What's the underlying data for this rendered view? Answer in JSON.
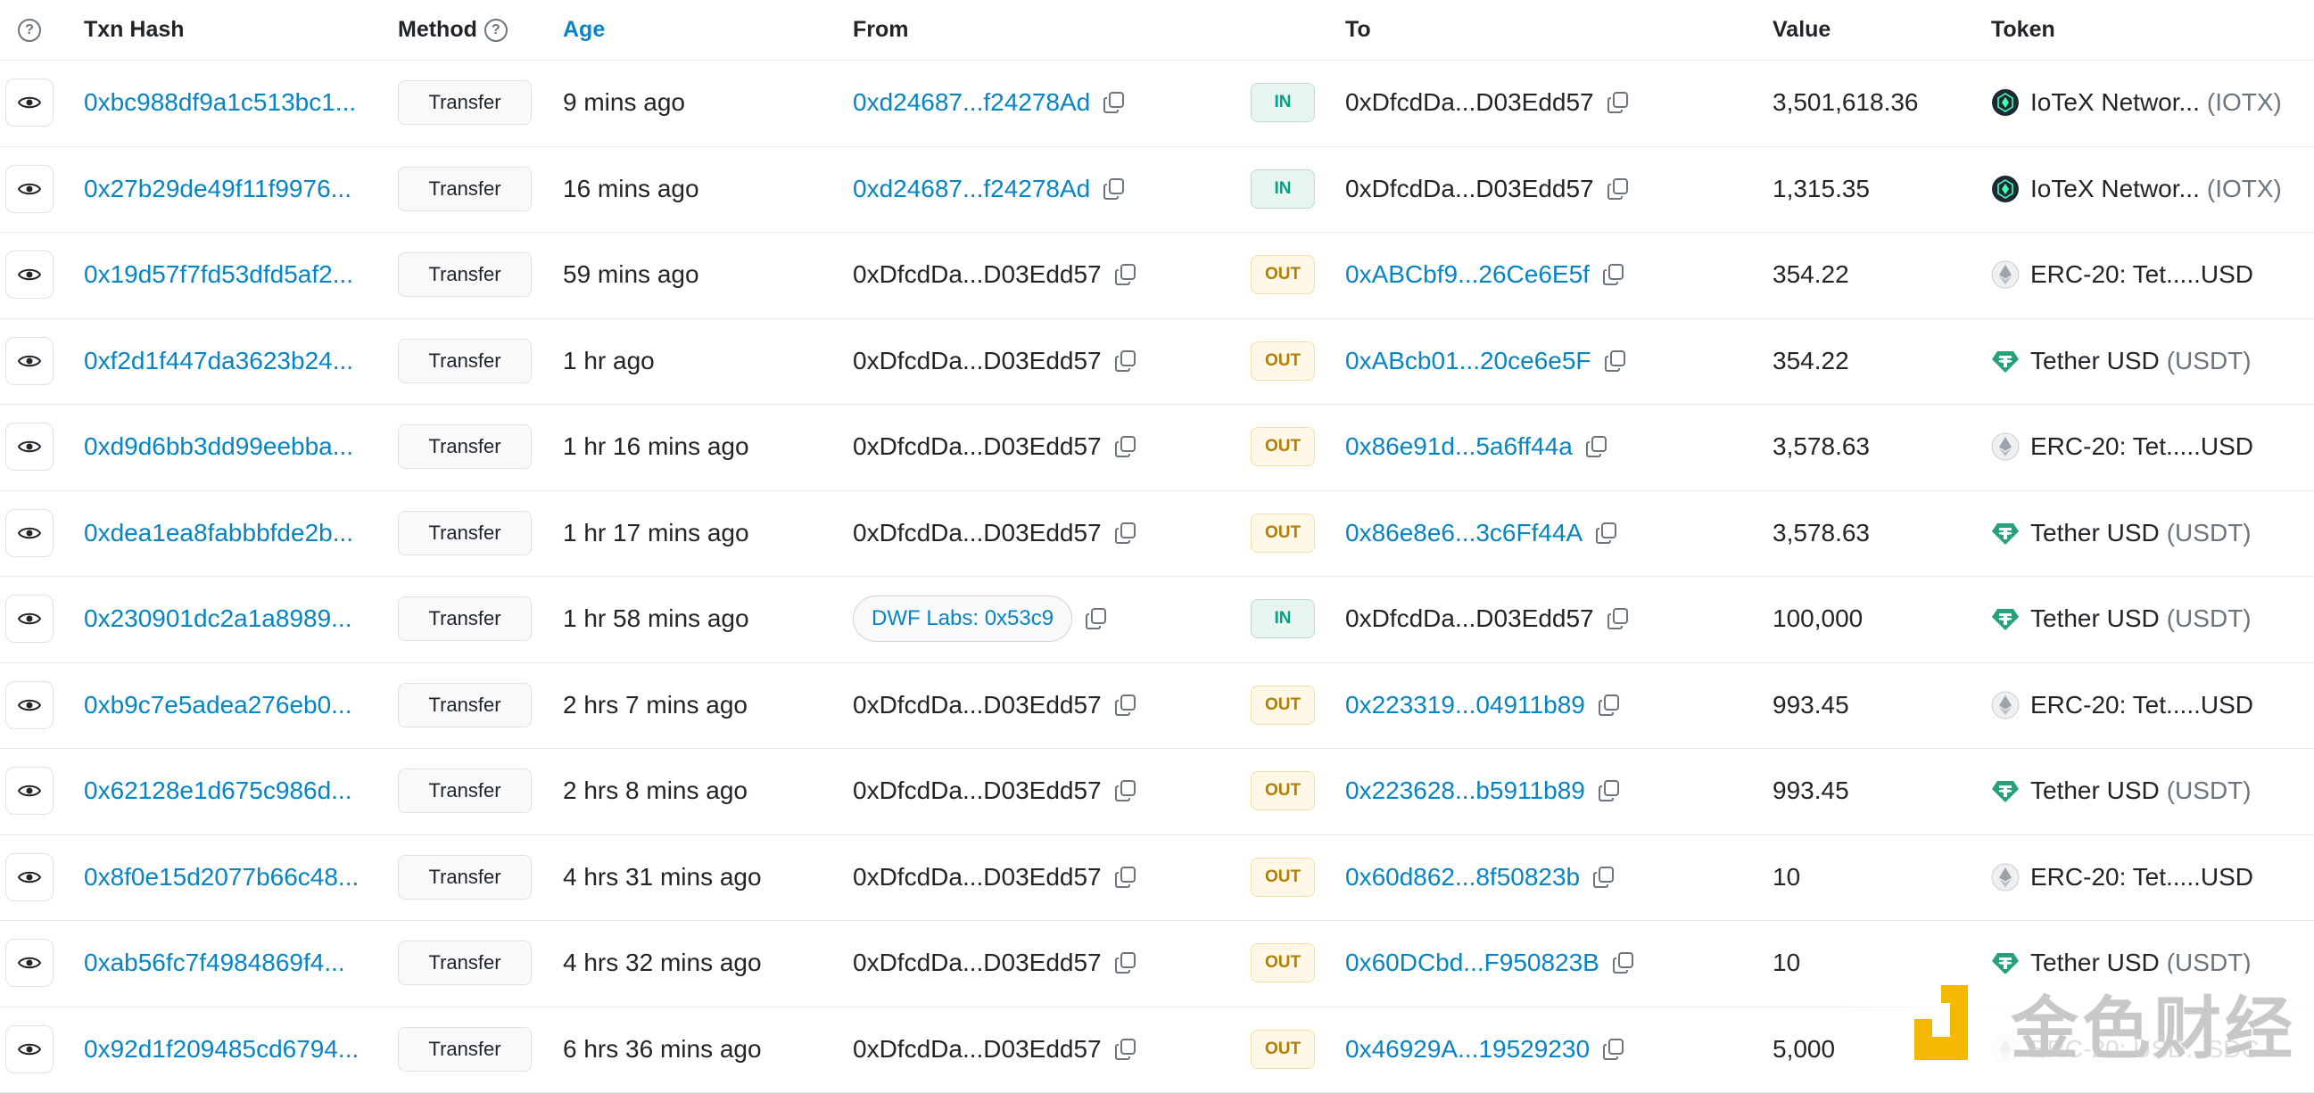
{
  "header": {
    "txn_hash": "Txn Hash",
    "method": "Method",
    "age": "Age",
    "from": "From",
    "to": "To",
    "value": "Value",
    "token": "Token"
  },
  "rows": [
    {
      "hash": "0xbc988df9a1c513bc1...",
      "method": "Transfer",
      "age": "9 mins ago",
      "from": "0xd24687...f24278Ad",
      "from_link": true,
      "dir": "IN",
      "to": "0xDfcdDa...D03Edd57",
      "to_link": false,
      "value": "3,501,618.36",
      "token": "IoTeX Networ...",
      "token_sym": "(IOTX)",
      "token_icon": "iotex-icon"
    },
    {
      "hash": "0x27b29de49f11f9976...",
      "method": "Transfer",
      "age": "16 mins ago",
      "from": "0xd24687...f24278Ad",
      "from_link": true,
      "dir": "IN",
      "to": "0xDfcdDa...D03Edd57",
      "to_link": false,
      "value": "1,315.35",
      "token": "IoTeX Networ...",
      "token_sym": "(IOTX)",
      "token_icon": "iotex-icon"
    },
    {
      "hash": "0x19d57f7fd53dfd5af2...",
      "method": "Transfer",
      "age": "59 mins ago",
      "from": "0xDfcdDa...D03Edd57",
      "from_link": false,
      "dir": "OUT",
      "to": "0xABCbf9...26Ce6E5f",
      "to_link": true,
      "value": "354.22",
      "token": "ERC-20: Tet.....USD",
      "token_sym": "",
      "token_icon": "eth-icon"
    },
    {
      "hash": "0xf2d1f447da3623b24...",
      "method": "Transfer",
      "age": "1 hr ago",
      "from": "0xDfcdDa...D03Edd57",
      "from_link": false,
      "dir": "OUT",
      "to": "0xABcb01...20ce6e5F",
      "to_link": true,
      "value": "354.22",
      "token": "Tether USD",
      "token_sym": "(USDT)",
      "token_icon": "tether-icon"
    },
    {
      "hash": "0xd9d6bb3dd99eebba...",
      "method": "Transfer",
      "age": "1 hr 16 mins ago",
      "from": "0xDfcdDa...D03Edd57",
      "from_link": false,
      "dir": "OUT",
      "to": "0x86e91d...5a6ff44a",
      "to_link": true,
      "value": "3,578.63",
      "token": "ERC-20: Tet.....USD",
      "token_sym": "",
      "token_icon": "eth-icon"
    },
    {
      "hash": "0xdea1ea8fabbbfde2b...",
      "method": "Transfer",
      "age": "1 hr 17 mins ago",
      "from": "0xDfcdDa...D03Edd57",
      "from_link": false,
      "dir": "OUT",
      "to": "0x86e8e6...3c6Ff44A",
      "to_link": true,
      "value": "3,578.63",
      "token": "Tether USD",
      "token_sym": "(USDT)",
      "token_icon": "tether-icon"
    },
    {
      "hash": "0x230901dc2a1a8989...",
      "method": "Transfer",
      "age": "1 hr 58 mins ago",
      "from": "DWF Labs: 0x53c9",
      "from_link": true,
      "from_tag": true,
      "dir": "IN",
      "to": "0xDfcdDa...D03Edd57",
      "to_link": false,
      "value": "100,000",
      "token": "Tether USD",
      "token_sym": "(USDT)",
      "token_icon": "tether-icon"
    },
    {
      "hash": "0xb9c7e5adea276eb0...",
      "method": "Transfer",
      "age": "2 hrs 7 mins ago",
      "from": "0xDfcdDa...D03Edd57",
      "from_link": false,
      "dir": "OUT",
      "to": "0x223319...04911b89",
      "to_link": true,
      "value": "993.45",
      "token": "ERC-20: Tet.....USD",
      "token_sym": "",
      "token_icon": "eth-icon"
    },
    {
      "hash": "0x62128e1d675c986d...",
      "method": "Transfer",
      "age": "2 hrs 8 mins ago",
      "from": "0xDfcdDa...D03Edd57",
      "from_link": false,
      "dir": "OUT",
      "to": "0x223628...b5911b89",
      "to_link": true,
      "value": "993.45",
      "token": "Tether USD",
      "token_sym": "(USDT)",
      "token_icon": "tether-icon"
    },
    {
      "hash": "0x8f0e15d2077b66c48...",
      "method": "Transfer",
      "age": "4 hrs 31 mins ago",
      "from": "0xDfcdDa...D03Edd57",
      "from_link": false,
      "dir": "OUT",
      "to": "0x60d862...8f50823b",
      "to_link": true,
      "value": "10",
      "token": "ERC-20: Tet.....USD",
      "token_sym": "",
      "token_icon": "eth-icon"
    },
    {
      "hash": "0xab56fc7f4984869f4...",
      "method": "Transfer",
      "age": "4 hrs 32 mins ago",
      "from": "0xDfcdDa...D03Edd57",
      "from_link": false,
      "dir": "OUT",
      "to": "0x60DCbd...F950823B",
      "to_link": true,
      "value": "10",
      "token": "Tether USD",
      "token_sym": "(USDT)",
      "token_icon": "tether-icon"
    },
    {
      "hash": "0x92d1f209485cd6794...",
      "method": "Transfer",
      "age": "6 hrs 36 mins ago",
      "from": "0xDfcdDa...D03Edd57",
      "from_link": false,
      "dir": "OUT",
      "to": "0x46929A...19529230",
      "to_link": true,
      "value": "5,000",
      "token": "ERC-20: USD...SDC",
      "token_sym": "",
      "token_icon": "eth-icon"
    }
  ],
  "watermark": {
    "text": "金色财经"
  },
  "colors": {
    "link": "#0784c3",
    "in": "#00a186",
    "out": "#b47d00",
    "tether": "#26a17b"
  }
}
